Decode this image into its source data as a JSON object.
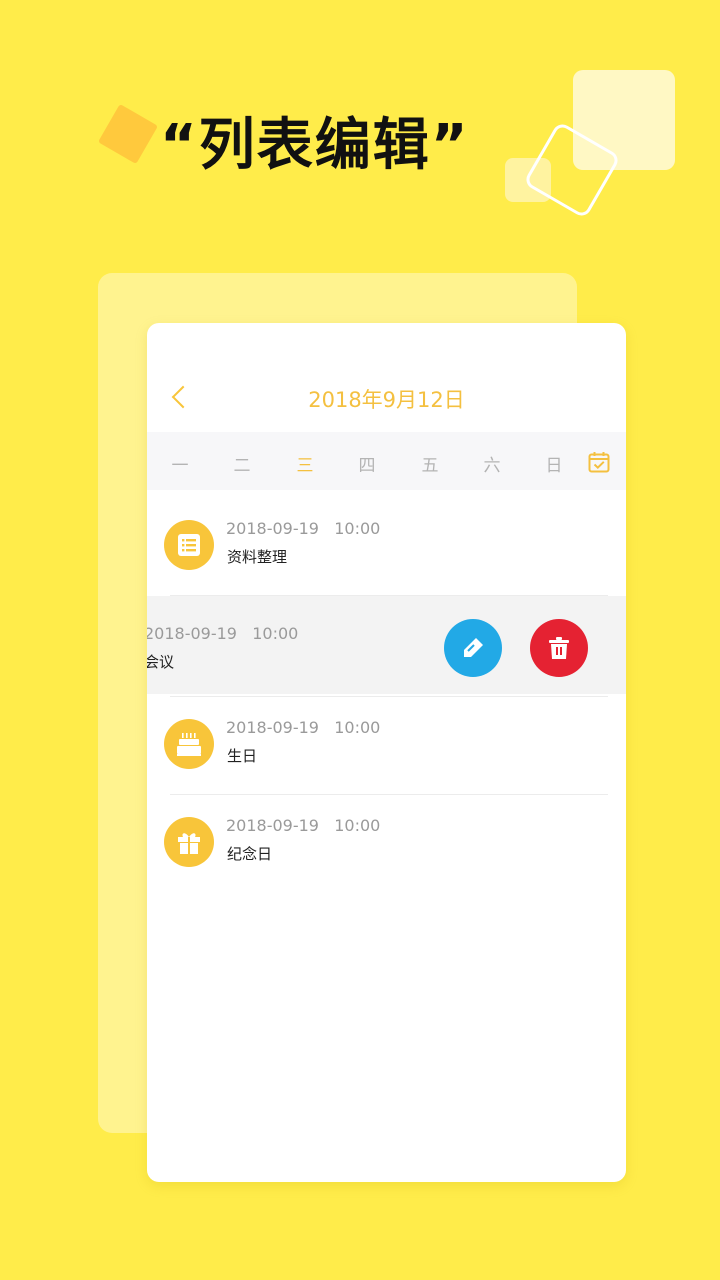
{
  "promo": {
    "headline": "“列表编辑”"
  },
  "nav": {
    "back_icon": "chevron-left-icon",
    "title": "2018年9月12日"
  },
  "weekbar": {
    "days": [
      "一",
      "二",
      "三",
      "四",
      "五",
      "六",
      "日"
    ],
    "active_index": 2,
    "calendar_icon": "calendar-check-icon"
  },
  "events": [
    {
      "time": "2018-09-19   10:00",
      "title": "资料整理",
      "icon": "list-icon"
    },
    {
      "time": "2018-09-19   10:00",
      "title": "会议",
      "icon": "meeting-icon",
      "swiped": true
    },
    {
      "time": "2018-09-19   10:00",
      "title": "生日",
      "icon": "birthday-cake-icon"
    },
    {
      "time": "2018-09-19   10:00",
      "title": "纪念日",
      "icon": "gift-icon"
    }
  ],
  "row_actions": {
    "edit_icon": "edit-pencil-icon",
    "delete_icon": "trash-icon"
  },
  "colors": {
    "background": "#ffec4a",
    "accent": "#f8c53a",
    "edit": "#22a9e6",
    "delete": "#e52232"
  }
}
